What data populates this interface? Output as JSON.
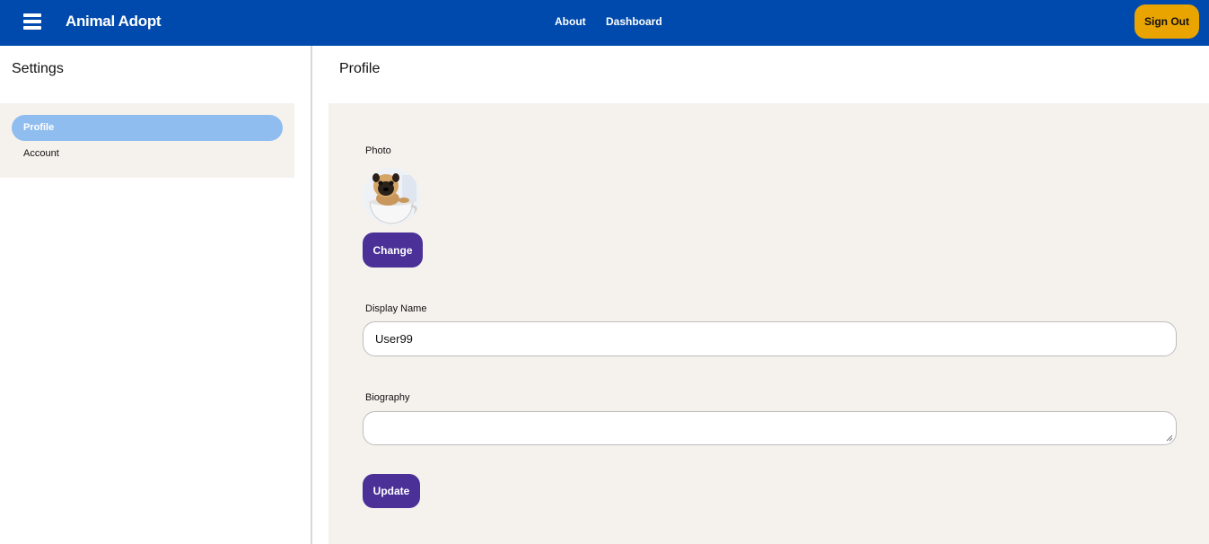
{
  "header": {
    "brand": "Animal Adopt",
    "nav": [
      {
        "label": "About"
      },
      {
        "label": "Dashboard"
      }
    ],
    "signout_label": "Sign Out",
    "colors": {
      "bar": "#004aad",
      "signout": "#eaa400"
    }
  },
  "sidebar": {
    "title": "Settings",
    "items": [
      {
        "label": "Profile",
        "active": true
      },
      {
        "label": "Account",
        "active": false
      }
    ]
  },
  "main": {
    "title": "Profile",
    "photo_label": "Photo",
    "change_label": "Change",
    "display_name_label": "Display Name",
    "display_name_value": "User99",
    "biography_label": "Biography",
    "biography_value": "",
    "update_label": "Update",
    "accent_color": "#4a3097"
  }
}
